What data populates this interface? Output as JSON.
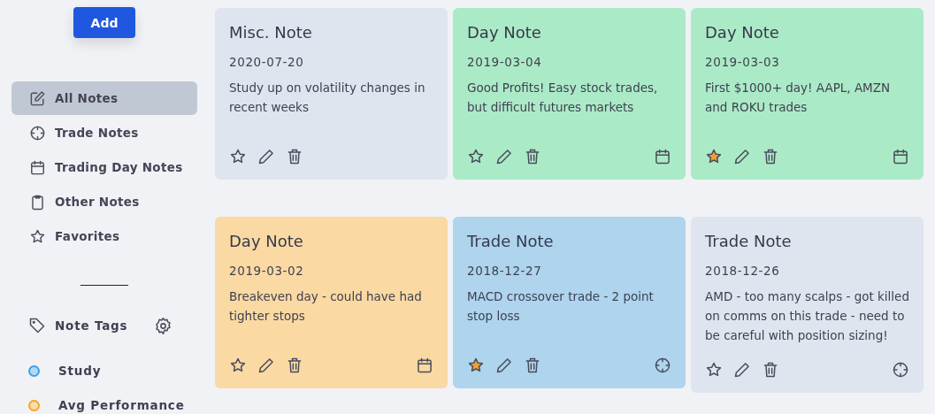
{
  "add_button": "Add",
  "nav": [
    {
      "label": "All Notes",
      "kind": "edit",
      "selected": true
    },
    {
      "label": "Trade Notes",
      "kind": "crosshair",
      "selected": false
    },
    {
      "label": "Trading Day Notes",
      "kind": "calendar",
      "selected": false
    },
    {
      "label": "Other Notes",
      "kind": "clipboard",
      "selected": false
    },
    {
      "label": "Favorites",
      "kind": "star",
      "selected": false
    }
  ],
  "tags_header": "Note Tags",
  "tags": [
    {
      "label": "Study",
      "color": "#3ba1e5"
    },
    {
      "label": "Avg Performance",
      "color": "#f5a623"
    }
  ],
  "notes": [
    {
      "title": "Misc. Note",
      "date": "2020-07-20",
      "text": "Study up on volatility changes in recent weeks",
      "kind": "misc",
      "color": "#dfe5ee",
      "favorite": false
    },
    {
      "title": "Day Note",
      "date": "2019-03-04",
      "text": "Good Profits! Easy stock trades, but difficult futures markets",
      "kind": "day",
      "color": "#abeac6",
      "favorite": false
    },
    {
      "title": "Day Note",
      "date": "2019-03-03",
      "text": "First $1000+ day! AAPL, AMZN and ROKU trades",
      "kind": "day",
      "color": "#abeac6",
      "favorite": true
    },
    {
      "title": "Day Note",
      "date": "2019-03-02",
      "text": "Breakeven day - could have had tighter stops",
      "kind": "day",
      "color": "#fbd9a3",
      "favorite": false
    },
    {
      "title": "Trade Note",
      "date": "2018-12-27",
      "text": "MACD crossover trade - 2 point stop loss",
      "kind": "trade",
      "color": "#aed4ee",
      "favorite": true
    },
    {
      "title": "Trade Note",
      "date": "2018-12-26",
      "text": "AMD - too many scalps - got killed on comms on this trade - need to be careful with position sizing!",
      "kind": "trade",
      "color": "#dfe5ee",
      "favorite": false
    }
  ]
}
